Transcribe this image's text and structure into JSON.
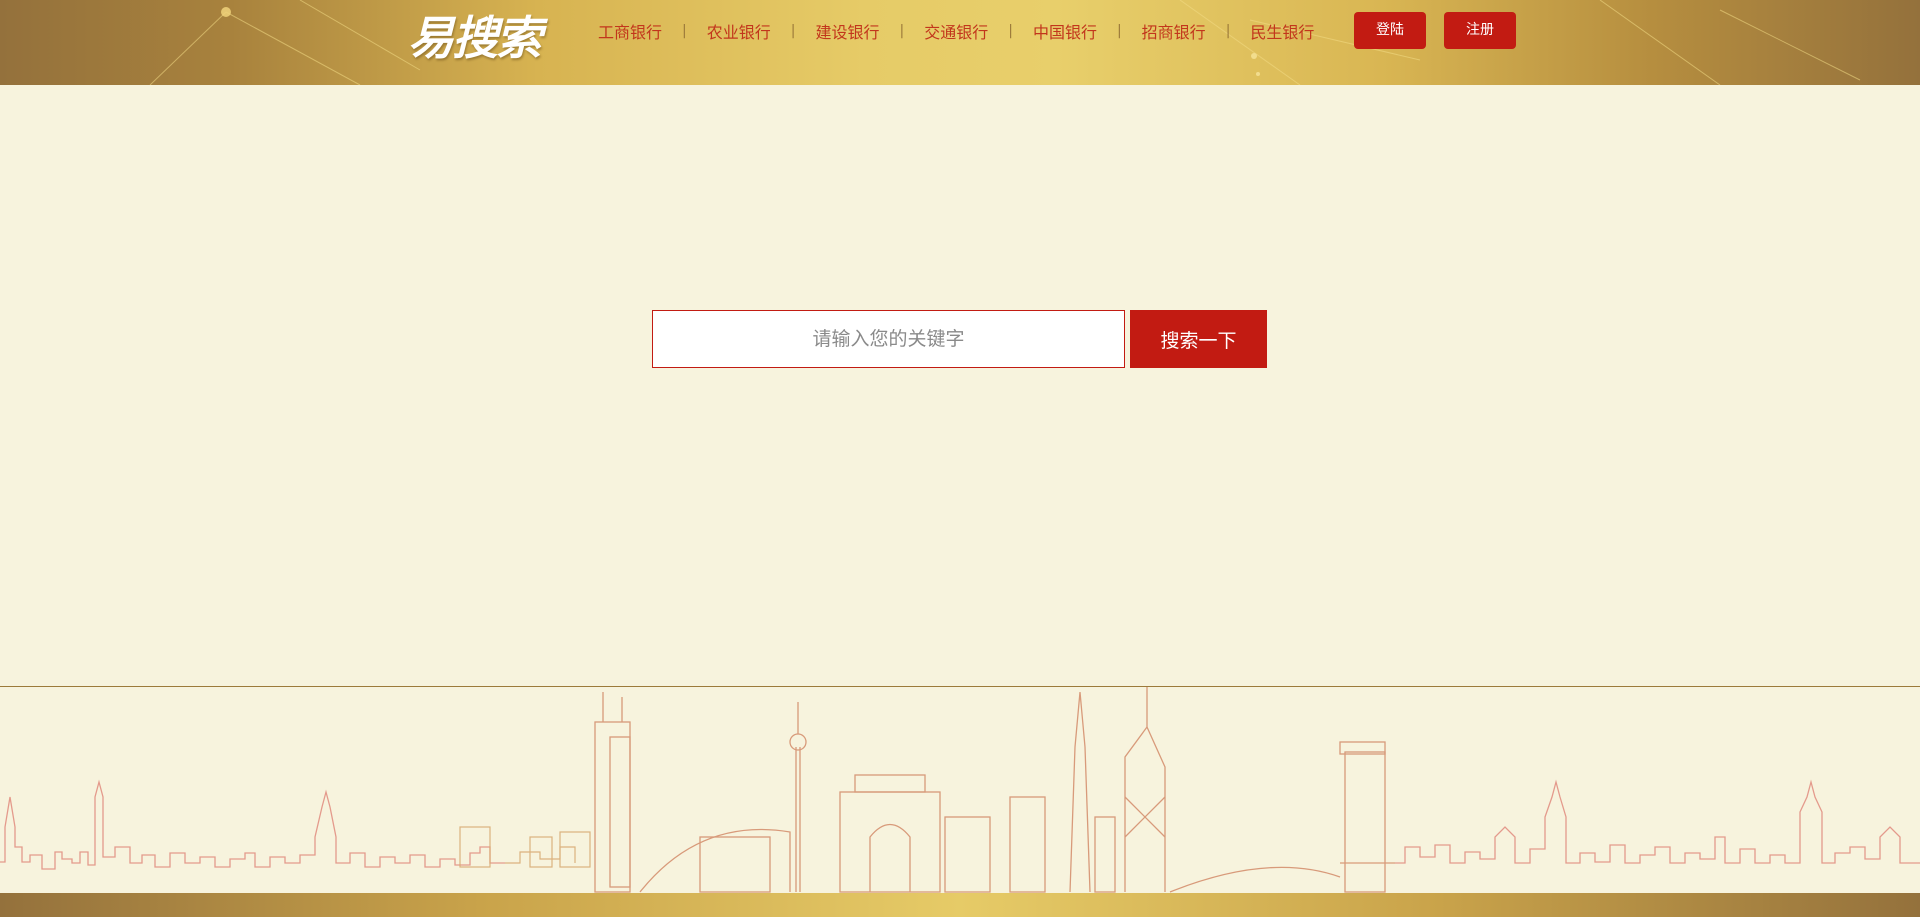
{
  "brand": {
    "logo_text": "易搜索"
  },
  "nav": {
    "items": [
      "工商银行",
      "农业银行",
      "建设银行",
      "交通银行",
      "中国银行",
      "招商银行",
      "民生银行"
    ],
    "separator": "|"
  },
  "auth": {
    "login_label": "登陆",
    "register_label": "注册"
  },
  "search": {
    "placeholder": "请输入您的关键字",
    "value": "",
    "button_label": "搜索一下"
  },
  "colors": {
    "accent": "#c21b12",
    "background": "#f7f3dd",
    "gold": "#d7b351"
  }
}
